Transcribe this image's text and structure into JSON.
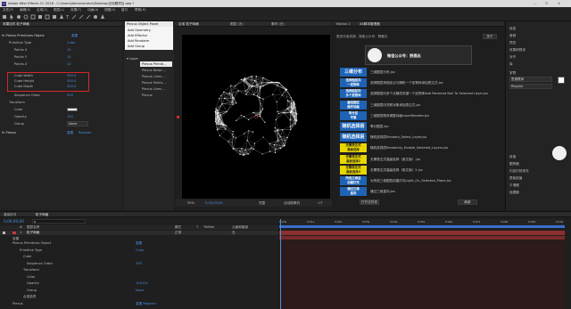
{
  "app": {
    "title": "Adobe After Effects CC 2018 - C:\\Users\\Administrator\\Desktop\\无标题项目.aep *",
    "window_controls": [
      "—",
      "☐",
      "✕"
    ]
  },
  "menu": [
    "文件(F)",
    "编辑(E)",
    "合成(C)",
    "图层(L)",
    "效果(T)",
    "动画(A)",
    "视图(V)",
    "窗口",
    "帮助(H)"
  ],
  "effect_controls": {
    "tab_label": "效果控件 粒子网格",
    "effect_name": "Plexus Primitives Object",
    "properties": [
      {
        "label": "Primitive Type",
        "value": "Cube"
      },
      {
        "label": "Points X",
        "value": "10"
      },
      {
        "label": "Points Y",
        "value": "10"
      },
      {
        "label": "Points Z",
        "value": "10"
      },
      {
        "label": "Cube Width",
        "value": "300.0"
      },
      {
        "label": "Cube Height",
        "value": "300.0"
      },
      {
        "label": "Cube Depth",
        "value": "300.0"
      },
      {
        "label": "Sequence Order",
        "value": "XYZ"
      },
      {
        "label": "Transform",
        "value": ""
      },
      {
        "label": "Color",
        "value": ""
      },
      {
        "label": "Opacity",
        "value": "100"
      },
      {
        "label": "Group",
        "value": "None"
      }
    ],
    "plexus_label": "Plexus",
    "reset_label": "重置",
    "register_label": "Register"
  },
  "plexus_menu": {
    "title": "Plexus Object Panel",
    "add_items": [
      "Add Geometry",
      "Add Effector",
      "Add Renderer",
      "Add Group"
    ],
    "layer_label": "Layer",
    "objects": [
      "Plexus Primiti...",
      "Plexus Noise ...",
      "Plexus Lines ...",
      "Plexus Points ...",
      "Plexus Lines ...",
      "Plexus"
    ]
  },
  "composition": {
    "tabs": [
      "合成 粒子网格",
      "图层 (无)",
      "素材 (无)"
    ],
    "bottom_bar": {
      "zoom": "50%",
      "timecode": "0;00;00;00",
      "quality": "完整",
      "camera": "活动摄像机",
      "views": "1个"
    }
  },
  "plugin_panel": {
    "tabs": [
      "Motion 2",
      "AE脚本管理器"
    ],
    "header_text": "更多作者资源，搜索公众号：野鹿志",
    "header_button": "关于",
    "wechat_banner": "微信公众号：野鹿志",
    "logo_text": "野鹿志",
    "ads": [
      {
        "label": "三维分布",
        "style": "blue"
      },
      {
        "label": "选择图层向\n一定物体",
        "style": "blue"
      },
      {
        "label": "选择图层向\n多个定物体",
        "style": "blue"
      },
      {
        "label": "重组图层\n操作动画",
        "style": "blue"
      },
      {
        "label": "等分层\n平面",
        "style": "blue"
      },
      {
        "label": "随机选择层",
        "style": "blue"
      },
      {
        "label": "随机选择层",
        "style": "blue"
      },
      {
        "label": "无需表达式\n高级选择",
        "style": "yellow"
      },
      {
        "label": "无需表达式\n高级选择2",
        "style": "yellow"
      },
      {
        "label": "无需表达式\n高级选择3",
        "style": "yellow"
      },
      {
        "label": "所选三维层\n创建灯光",
        "style": "blue"
      },
      {
        "label": "通过三维\n直向",
        "style": "blue"
      }
    ],
    "scripts": [
      "三维图层分布.jsx",
      "选择图层到指定点与随机一个定物体添加表达式.jsx",
      "选择图层向多个点随机关键一个定物体Add Parented Null To Selected Layer.jsx",
      "三维图层向关联对象添加表达式.jsx",
      "三维图层顺序调整动画LayerReorder.jsx",
      "等分图层.jsx",
      "随机选择层Random_Select_Layer.jsx",
      "随机选择层Randomly_Enable_Selected_Layers.jsx",
      "无需表达式高级选择（英文版）.jsx",
      "无需表达式高级选择（英文版）2.jsx",
      "为所选三维图层创建灯光Light_On_Selected_Plane.jsx",
      "通过三维直向.jsx"
    ],
    "footer_left": "打开文件夹",
    "footer_right": "刷新"
  },
  "right_panel": {
    "items": [
      "信息",
      "音频",
      "预览",
      "效果和预设",
      "对齐",
      "库",
      "字符",
      "段落",
      "跟踪器",
      "内容识别填充",
      "蒙版插值",
      "平滑器",
      "摇摆器"
    ],
    "font_label": "思源黑体",
    "font_style": "Regular"
  },
  "timeline": {
    "tab_label": "渲染队列",
    "comp_tab": "粒子网格",
    "timecode": "0;00;00;00",
    "search_placeholder": "ρ",
    "columns": [
      "#",
      "图层名称",
      "模式",
      "T",
      "TrkMat",
      "父级和链接"
    ],
    "layer": {
      "index": "1",
      "name": "粒子网格",
      "mode": "正常",
      "parent": "无"
    },
    "effects_label": "效果",
    "rows": [
      {
        "label": "Plexus Primitives Object",
        "value": "重置"
      },
      {
        "label": "Primitive Type",
        "value": "Cube"
      },
      {
        "label": "Cube",
        "value": ""
      },
      {
        "label": "Sequence Order",
        "value": "XYZ"
      },
      {
        "label": "Transform",
        "value": ""
      },
      {
        "label": "Color",
        "value": ""
      },
      {
        "label": "Opacity",
        "value": "100.0%"
      },
      {
        "label": "Group",
        "value": "None"
      },
      {
        "label": "合成选项",
        "value": ""
      },
      {
        "label": "Plexus",
        "value": "重置 Register"
      }
    ],
    "ruler": [
      "0;00s",
      "0;01s",
      "0;02s",
      "0;03s",
      "0;04s",
      "0;05s",
      "0;06s",
      "0;07s",
      "0;08s",
      "0;09s",
      "0;10s"
    ]
  },
  "colors": {
    "accent": "#4a8fe0",
    "highlight": "#d42828",
    "work_area": "#3a6fd0",
    "layer_bar": "#8b2f2f"
  }
}
